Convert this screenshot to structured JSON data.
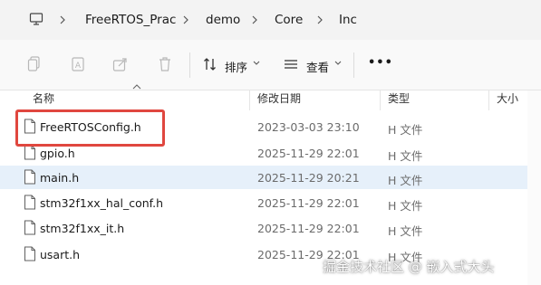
{
  "breadcrumb": [
    "FreeRTOS_Prac",
    "demo",
    "Core",
    "Inc"
  ],
  "toolbar": {
    "sort_label": "排序",
    "view_label": "查看",
    "more_label": "•••"
  },
  "columns": {
    "name": "名称",
    "date": "修改日期",
    "type": "类型",
    "size": "大小"
  },
  "files": [
    {
      "name": "FreeRTOSConfig.h",
      "date": "2023-03-03 23:10",
      "type": "H 文件"
    },
    {
      "name": "gpio.h",
      "date": "2025-11-29 22:01",
      "type": "H 文件"
    },
    {
      "name": "main.h",
      "date": "2025-11-29 20:21",
      "type": "H 文件"
    },
    {
      "name": "stm32f1xx_hal_conf.h",
      "date": "2025-11-29 22:01",
      "type": "H 文件"
    },
    {
      "name": "stm32f1xx_it.h",
      "date": "2025-11-29 22:01",
      "type": "H 文件"
    },
    {
      "name": "usart.h",
      "date": "2025-11-29 22:01",
      "type": "H 文件"
    }
  ],
  "watermark": "掘金技术社区 @ 嵌入式大头",
  "colors": {
    "highlight": "#e0473f",
    "selected_row": "#e6f0fa"
  }
}
